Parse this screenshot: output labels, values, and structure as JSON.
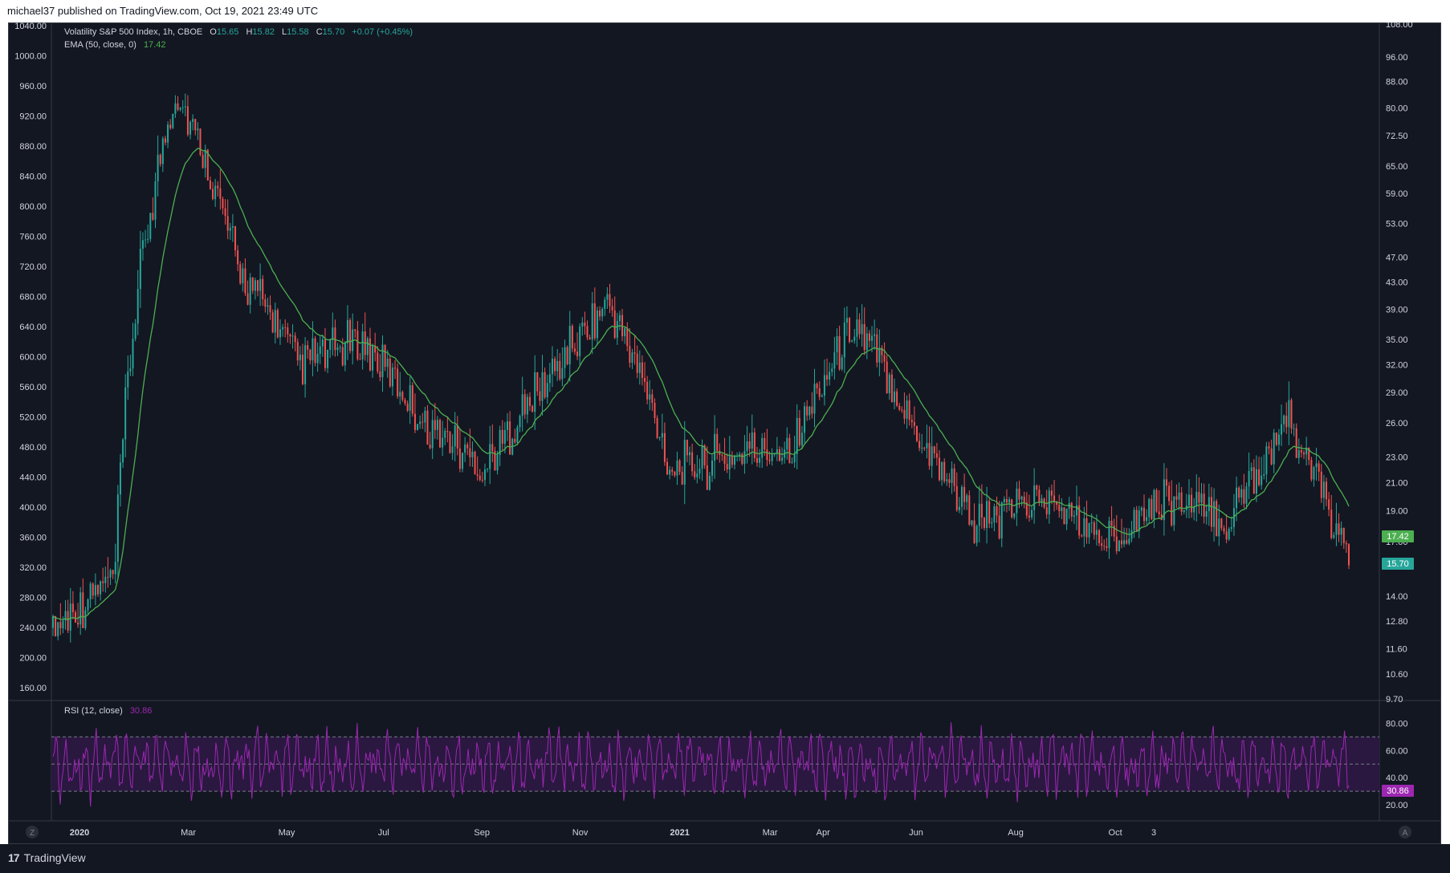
{
  "header": {
    "published": "michael37 published on TradingView.com, Oct 19, 2021 23:49 UTC"
  },
  "footer": {
    "brand": "TradingView",
    "brand_mark": "17"
  },
  "legend": {
    "symbol": "Volatility S&P 500 Index, 1h, CBOE",
    "o_label": "O",
    "o_val": "15.65",
    "h_label": "H",
    "h_val": "15.82",
    "l_label": "L",
    "l_val": "15.58",
    "c_label": "C",
    "c_val": "15.70",
    "change": "+0.07 (+0.45%)",
    "ema_label": "EMA (50, close, 0)",
    "ema_val": "17.42",
    "rsi_label": "RSI (12, close)",
    "rsi_val": "30.86"
  },
  "badges": {
    "ema": "17.42",
    "close": "15.70",
    "rsi": "30.86"
  },
  "colors": {
    "background": "#131722",
    "grid_line": "#363a45",
    "axis_text": "#d1d4dc",
    "candle_up": "#26a69a",
    "candle_down": "#ef5350",
    "ema": "#4caf50",
    "rsi_line": "#9c27b0",
    "rsi_band": "#2a1840",
    "badge_ema": "#4caf50",
    "badge_close": "#26a69a",
    "badge_rsi": "#9c27b0"
  },
  "buttons": {
    "left_scale": "Z",
    "auto_scale": "A"
  },
  "chart_data": [
    {
      "type": "candlestick",
      "title": "Volatility S&P 500 Index, 1h, CBOE",
      "left_axis_ticks": [
        "1040.00",
        "1000.00",
        "960.00",
        "920.00",
        "880.00",
        "840.00",
        "800.00",
        "760.00",
        "720.00",
        "680.00",
        "640.00",
        "600.00",
        "560.00",
        "520.00",
        "480.00",
        "440.00",
        "400.00",
        "360.00",
        "320.00",
        "280.00",
        "240.00",
        "200.00",
        "160.00"
      ],
      "right_axis_ticks": [
        "108.00",
        "96.00",
        "88.00",
        "80.00",
        "72.50",
        "65.00",
        "59.00",
        "53.00",
        "47.00",
        "43.00",
        "39.00",
        "35.00",
        "32.00",
        "29.00",
        "26.00",
        "23.00",
        "21.00",
        "19.00",
        "17.00",
        "14.00",
        "12.80",
        "11.60",
        "10.60",
        "9.70"
      ],
      "x_tick_labels": [
        "2020",
        "Mar",
        "May",
        "Jul",
        "Sep",
        "Nov",
        "2021",
        "Mar",
        "Apr",
        "Jun",
        "Aug",
        "Oct",
        "3"
      ],
      "x_tick_frac": [
        0.0,
        0.082,
        0.156,
        0.229,
        0.303,
        0.377,
        0.452,
        0.52,
        0.56,
        0.63,
        0.705,
        0.78,
        0.809
      ],
      "x": [
        "2020-01",
        "2020-02",
        "2020-03",
        "2020-04",
        "2020-05",
        "2020-06",
        "2020-07",
        "2020-08",
        "2020-09",
        "2020-10",
        "2020-11",
        "2020-12",
        "2021-01",
        "2021-02",
        "2021-03",
        "2021-04",
        "2021-05",
        "2021-06",
        "2021-07",
        "2021-08",
        "2021-09",
        "2021-10"
      ],
      "key_points_y_right_axis": [
        12.5,
        15.0,
        85.0,
        45.0,
        32.0,
        35.0,
        26.0,
        22.0,
        30.0,
        40.0,
        22.0,
        23.0,
        24.0,
        37.0,
        25.0,
        18.0,
        20.0,
        17.0,
        20.0,
        18.0,
        26.0,
        15.7
      ],
      "series": [
        {
          "name": "EMA (50, close, 0)",
          "last": 17.42
        }
      ],
      "last_close": 15.7
    },
    {
      "type": "line",
      "title": "RSI (12, close)",
      "y_ticks": [
        "80.00",
        "60.00",
        "40.00",
        "20.00"
      ],
      "bands": [
        70,
        50,
        30
      ],
      "series": [
        {
          "name": "RSI (12, close)",
          "last": 30.86
        }
      ]
    }
  ]
}
